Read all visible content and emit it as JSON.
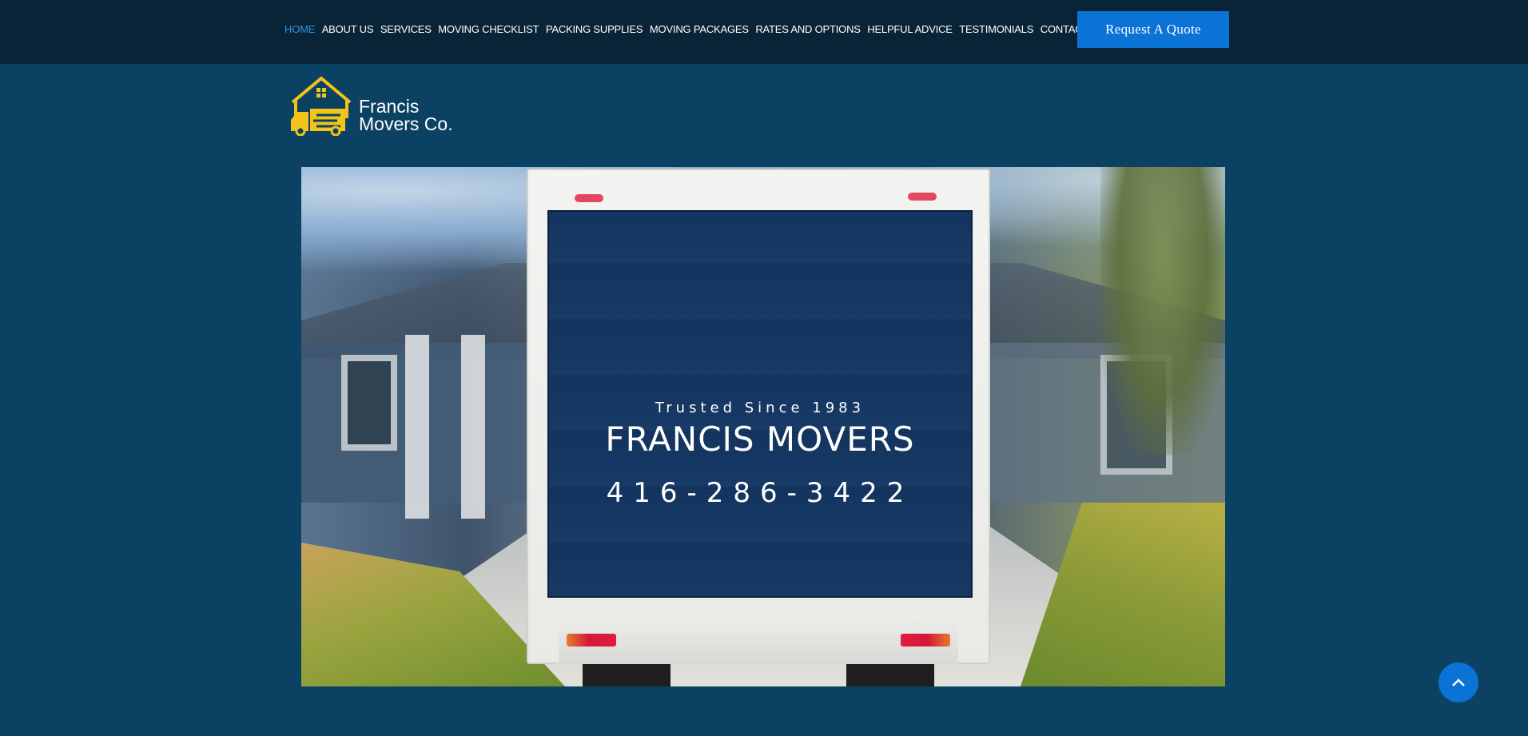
{
  "nav": {
    "items": [
      {
        "label": "HOME",
        "active": true
      },
      {
        "label": "ABOUT US"
      },
      {
        "label": "SERVICES"
      },
      {
        "label": "MOVING CHECKLIST"
      },
      {
        "label": "PACKING SUPPLIES"
      },
      {
        "label": "MOVING PACKAGES"
      },
      {
        "label": "RATES AND OPTIONS"
      },
      {
        "label": "HELPFUL ADVICE"
      },
      {
        "label": "TESTIMONIALS"
      },
      {
        "label": "CONTACT US"
      }
    ]
  },
  "quote_button": "Request A Quote",
  "logo": {
    "line1": "Francis",
    "line2": "Movers Co."
  },
  "hero": {
    "tagline": "Trusted Since 1983",
    "brand": "FRANCIS MOVERS",
    "phone": "416-286-3422"
  },
  "colors": {
    "header_bg": "#0a2437",
    "page_bg": "#0b4264",
    "accent": "#0b73d6",
    "nav_active": "#2a95e6",
    "logo_yellow": "#f2c318"
  },
  "icons": {
    "scroll_top": "chevron-up-icon",
    "logo": "house-truck-logo-icon"
  }
}
